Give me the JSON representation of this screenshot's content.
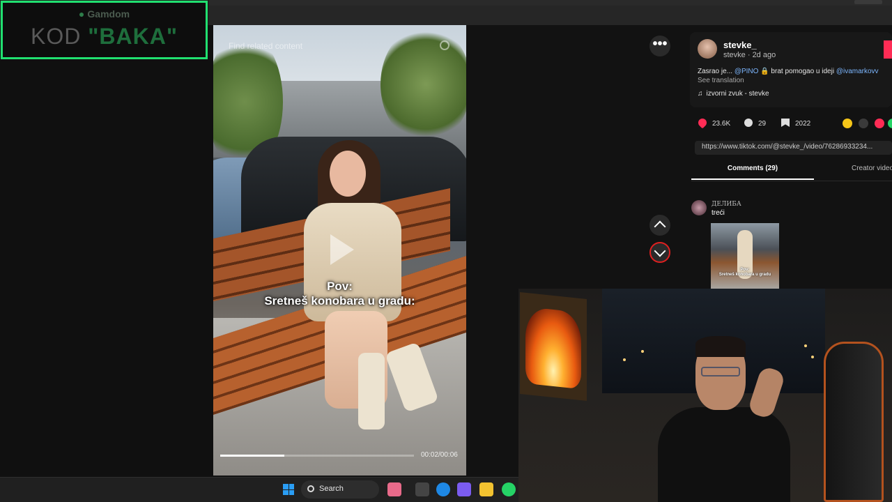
{
  "promo": {
    "brand": "Gamdom",
    "code_prefix": "KOD",
    "code_value": "\"BAKA\""
  },
  "video": {
    "find_related": "Find related content",
    "caption_line1": "Pov:",
    "caption_line2": "Sretneš konobara u gradu:",
    "timestamp": "00:02/00:06",
    "progress": 0.33
  },
  "post": {
    "username": "stevke_",
    "subline": "stevke · 2d ago",
    "desc_part1": "Zasrao je... ",
    "mention1": "@PINO",
    "desc_part2": " 🔒 brat pomogao u ideji ",
    "mention2": "@ivamarkovv",
    "see_translation": "See translation",
    "music": "izvorni zvuk - stevke",
    "likes": "23.6K",
    "comments": "29",
    "saves": "2022",
    "url": "https://www.tiktok.com/@stevke_/video/76286933234..."
  },
  "tabs": {
    "comments": "Comments (29)",
    "creator": "Creator videos"
  },
  "comment": {
    "user": "ДЕЛИБА",
    "text": "treći",
    "thumb_line1": "Pov:",
    "thumb_line2": "Sretneš konobara u gradu"
  },
  "controls": {
    "more": "•••"
  },
  "taskbar": {
    "search_label": "Search"
  },
  "colors": {
    "accent_red": "#fe2c55",
    "promo_border": "#20e070",
    "mention_blue": "#7db7ff"
  }
}
